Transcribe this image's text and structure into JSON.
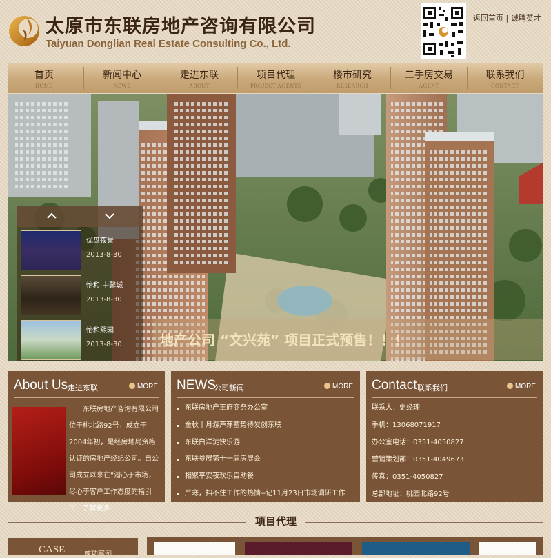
{
  "header": {
    "company_cn": "太原市东联房地产咨询有限公司",
    "company_en": "Taiyuan Donglian Real Estate Consulting Co., Ltd.",
    "links": {
      "home": "返回首页",
      "separator": "|",
      "jobs": "诚聘英才"
    }
  },
  "nav": [
    {
      "cn": "首页",
      "en": "HOME"
    },
    {
      "cn": "新闻中心",
      "en": "NEWS"
    },
    {
      "cn": "走进东联",
      "en": "ABOUT"
    },
    {
      "cn": "项目代理",
      "en": "PROJECT AGENTS"
    },
    {
      "cn": "楼市研究",
      "en": "RESEARCH"
    },
    {
      "cn": "二手房交易",
      "en": "AGENT"
    },
    {
      "cn": "联系我们",
      "en": "CONTACT"
    }
  ],
  "banner": {
    "caption": "地产公司 “文兴苑” 项目正式预售！！！",
    "thumbs": [
      {
        "title": "优盘夜景",
        "date": "2013-8-30"
      },
      {
        "title": "怡和·中馨城",
        "date": "2013-8-30"
      },
      {
        "title": "怡和熙园",
        "date": "2013-8-30"
      }
    ]
  },
  "about": {
    "title_en": "About Us",
    "title_cn": "走进东联",
    "more": "MORE",
    "text": "东联房地产咨询有限公司位于桃北路92号，成立于2004年初，是经房地局资格认证的房地产经纪公司。自公司成立以来在“潜心于市场，尽心于客户工作态度的指引下...",
    "more_link": "了解更多"
  },
  "news": {
    "title_en": "NEWS",
    "title_cn": "公司新闻",
    "more": "MORE",
    "items": [
      "东联房地产王府商务办公室",
      "金秋十月游芦芽蓄势待发创东联",
      "东联白洋淀快乐游",
      "东联参展第十一届房展会",
      "相聚平安夜欢乐自助餐",
      "严寒，挡不住工作的热情--记11月23日市场调研工作"
    ]
  },
  "contact": {
    "title_en": "Contact",
    "title_cn": "联系我们",
    "more": "MORE",
    "items": [
      "联系人：史经理",
      "手机：13068071917",
      "办公室电话：0351-4050827",
      "营销策划部：0351-4049673",
      "传真：0351-4050827",
      "总部地址：桃园北路92号"
    ]
  },
  "projects": {
    "section_title": "项目代理",
    "case_en": "CASE",
    "case_cn": "成功案例"
  },
  "colors": {
    "brown": "#7a5436",
    "nav_gold": "#c9a879",
    "caption": "#f4e3bd"
  }
}
